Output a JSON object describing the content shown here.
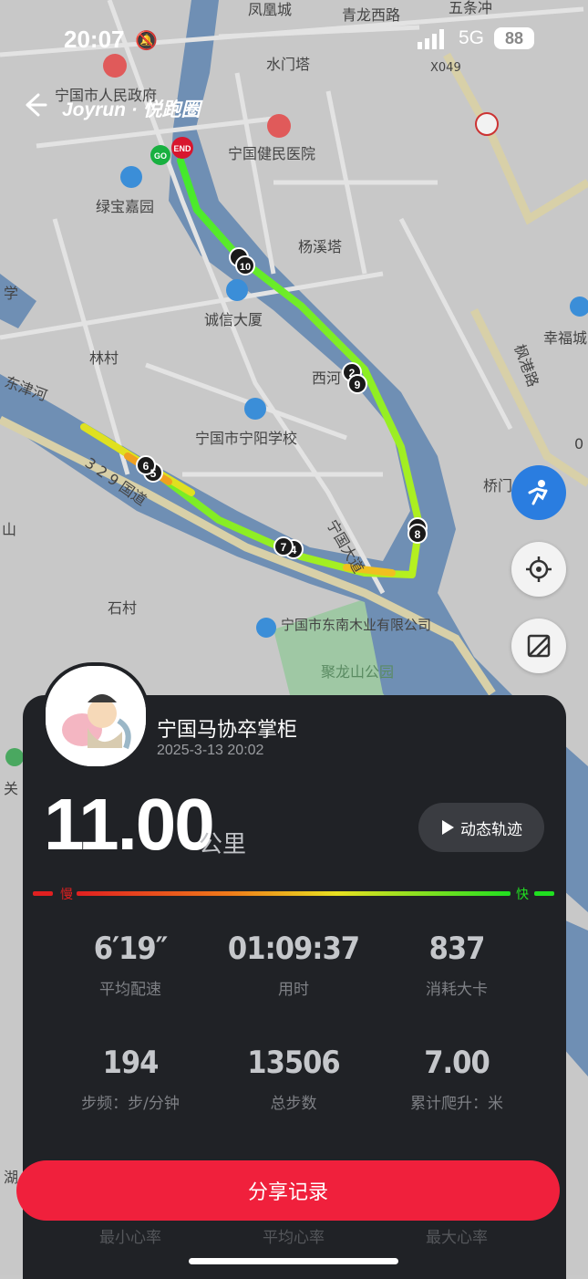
{
  "status": {
    "time": "20:07",
    "network": "5G",
    "battery": "88"
  },
  "header": {
    "brand": "Joyrun · 悦跑圈"
  },
  "map": {
    "labels": [
      "凤凰城",
      "青龙西路",
      "五条冲",
      "水门塔",
      "X049",
      "宁国市人民政府",
      "宁国健民医院",
      "绿宝嘉园",
      "杨溪塔",
      "学",
      "诚信大厦",
      "幸福城",
      "林村",
      "西河",
      "枫港路",
      "东津河",
      "宁国市宁阳学校",
      "桥门",
      "3 2 9 国道",
      "山",
      "宁国大道",
      "石村",
      "宁国市东南木业有限公司",
      "聚龙山公园",
      "关",
      "湖",
      "0"
    ],
    "markers": {
      "start": "GO",
      "end": "END",
      "km": [
        "5",
        "6",
        "7",
        "4",
        "8",
        "9",
        "10",
        "2"
      ]
    }
  },
  "user": {
    "name": "宁国马协卒掌柜",
    "datetime": "2025-3-13 20:02"
  },
  "run": {
    "distance": "11.00",
    "unit": "公里",
    "replay_label": "动态轨迹"
  },
  "speed_legend": {
    "slow": "慢",
    "fast": "快"
  },
  "stats": [
    {
      "value": "6′19″",
      "label": "平均配速"
    },
    {
      "value": "01:09:37",
      "label": "用时"
    },
    {
      "value": "837",
      "label": "消耗大卡"
    },
    {
      "value": "194",
      "label": "步频：步/分钟"
    },
    {
      "value": "13506",
      "label": "总步数"
    },
    {
      "value": "7.00",
      "label": "累计爬升：米"
    }
  ],
  "faded_labels": [
    "最小心率",
    "平均心率",
    "最大心率"
  ],
  "share_label": "分享记录",
  "colors": {
    "accent": "#f0203c",
    "panel": "#202226"
  }
}
